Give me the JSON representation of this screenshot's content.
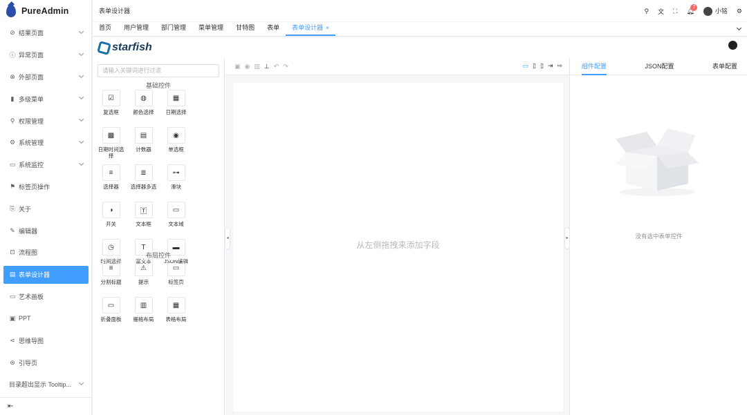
{
  "app": {
    "title": "PureAdmin"
  },
  "sidebar": {
    "items": [
      {
        "label": "结果页面",
        "icon": "check-circle-icon",
        "glyph": "⊘",
        "expandable": true
      },
      {
        "label": "异常页面",
        "icon": "info-circle-icon",
        "glyph": "ⓘ",
        "expandable": true
      },
      {
        "label": "外部页面",
        "icon": "link-icon",
        "glyph": "⊗",
        "expandable": true
      },
      {
        "label": "多级菜单",
        "icon": "bar-chart-icon",
        "glyph": "▮",
        "expandable": true
      },
      {
        "label": "权限管理",
        "icon": "key-icon",
        "glyph": "⚲",
        "expandable": true
      },
      {
        "label": "系统管理",
        "icon": "gear-icon",
        "glyph": "⚙",
        "expandable": true
      },
      {
        "label": "系统监控",
        "icon": "monitor-icon",
        "glyph": "▭",
        "expandable": true
      },
      {
        "label": "标签页操作",
        "icon": "bookmark-icon",
        "glyph": "⚑",
        "expandable": false
      },
      {
        "label": "关于",
        "icon": "about-icon",
        "glyph": "⎘",
        "expandable": false
      },
      {
        "label": "编辑器",
        "icon": "edit-icon",
        "glyph": "✎",
        "expandable": false
      },
      {
        "label": "流程图",
        "icon": "flowchart-icon",
        "glyph": "⊡",
        "expandable": false
      },
      {
        "label": "表单设计器",
        "icon": "form-icon",
        "glyph": "▤",
        "expandable": false,
        "active": true
      },
      {
        "label": "艺术画板",
        "icon": "board-icon",
        "glyph": "▭",
        "expandable": false
      },
      {
        "label": "PPT",
        "icon": "ppt-icon",
        "glyph": "▣",
        "expandable": false
      },
      {
        "label": "思维导图",
        "icon": "mindmap-icon",
        "glyph": "⋖",
        "expandable": false
      },
      {
        "label": "引导页",
        "icon": "guide-icon",
        "glyph": "⊜",
        "expandable": false
      },
      {
        "label": "目录超出显示 Tooltip...",
        "icon": "",
        "glyph": "",
        "expandable": true
      }
    ],
    "collapse_icon": "menu-fold-icon"
  },
  "header": {
    "breadcrumb": "表单设计器",
    "notification_count": "7",
    "user_name": "小铭"
  },
  "tabs": [
    {
      "label": "首页"
    },
    {
      "label": "用户管理"
    },
    {
      "label": "部门管理"
    },
    {
      "label": "菜单管理"
    },
    {
      "label": "甘特图"
    },
    {
      "label": "表单"
    },
    {
      "label": "表单设计器",
      "active": true,
      "closable": true
    }
  ],
  "designer": {
    "brand": "starfish",
    "search_placeholder": "请输入关键词进行过滤",
    "basic_section": "基础控件",
    "basic": [
      {
        "label": "复选框",
        "glyph": "☑",
        "icon": "checkbox-icon"
      },
      {
        "label": "颜色选择",
        "glyph": "◍",
        "icon": "palette-icon"
      },
      {
        "label": "日期选择",
        "glyph": "▦",
        "icon": "calendar-icon"
      },
      {
        "label": "日期时间选择",
        "glyph": "▩",
        "icon": "datetime-icon"
      },
      {
        "label": "计数器",
        "glyph": "▤",
        "icon": "counter-icon"
      },
      {
        "label": "单选框",
        "glyph": "◉",
        "icon": "radio-icon"
      },
      {
        "label": "选择器",
        "glyph": "≡",
        "icon": "select-icon"
      },
      {
        "label": "选择器多选",
        "glyph": "≣",
        "icon": "multi-select-icon"
      },
      {
        "label": "滑块",
        "glyph": "⊶",
        "icon": "slider-icon"
      },
      {
        "label": "开关",
        "glyph": "◑",
        "icon": "switch-icon"
      },
      {
        "label": "文本框",
        "glyph": "🅃",
        "icon": "textbox-icon"
      },
      {
        "label": "文本域",
        "glyph": "▭",
        "icon": "textarea-icon"
      },
      {
        "label": "时间选择",
        "glyph": "◷",
        "icon": "clock-icon"
      },
      {
        "label": "富文本",
        "glyph": "T",
        "icon": "richtext-icon"
      },
      {
        "label": "JSON编辑",
        "glyph": "▬",
        "icon": "json-icon"
      }
    ],
    "layout_section": "布局控件",
    "layout": [
      {
        "label": "分割标题",
        "glyph": "≡",
        "icon": "divider-icon"
      },
      {
        "label": "提示",
        "glyph": "⚠",
        "icon": "alert-icon"
      },
      {
        "label": "标签页",
        "glyph": "▭",
        "icon": "tabs-icon"
      },
      {
        "label": "折叠面板",
        "glyph": "▭",
        "icon": "collapse-icon"
      },
      {
        "label": "栅格布局",
        "glyph": "▥",
        "icon": "grid-icon"
      },
      {
        "label": "表格布局",
        "glyph": "▦",
        "icon": "table-icon"
      }
    ],
    "canvas_hint": "从左侧拖拽来添加字段",
    "right_tabs": [
      {
        "label": "组件配置",
        "active": true
      },
      {
        "label": "JSON配置"
      },
      {
        "label": "表单配置"
      }
    ],
    "empty_text": "没有选中表单控件"
  }
}
